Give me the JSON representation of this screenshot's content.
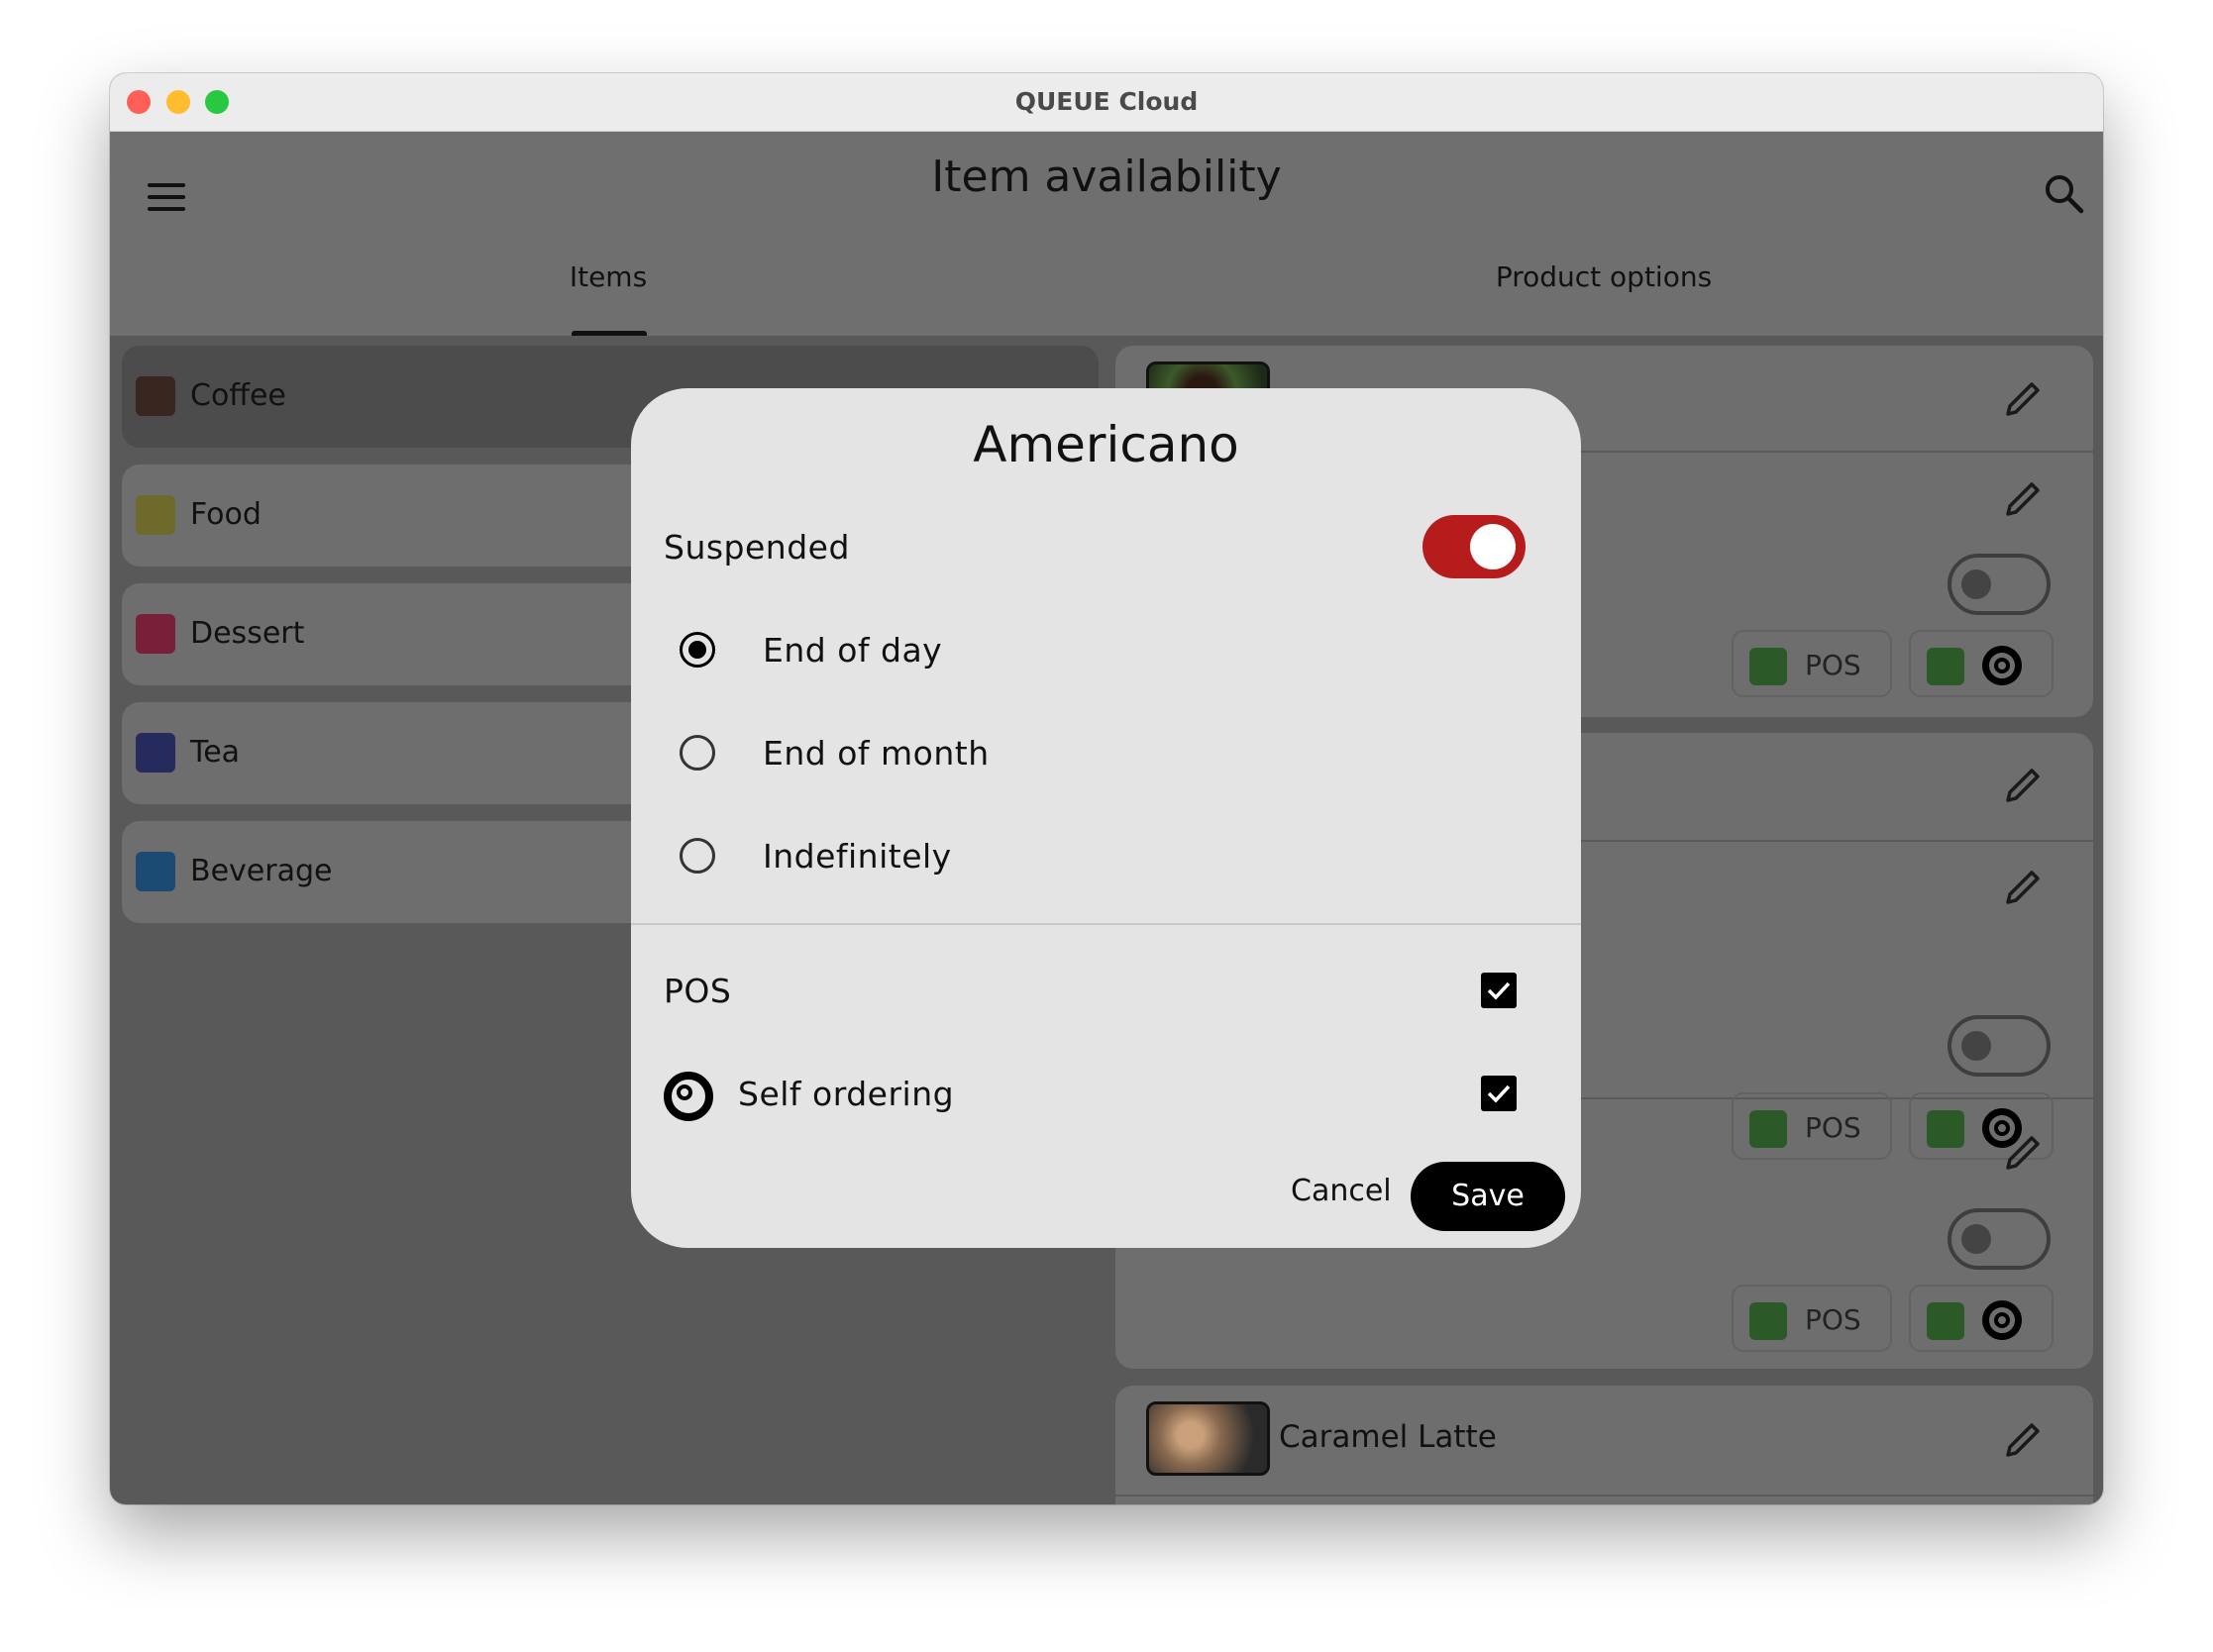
{
  "window": {
    "title": "QUEUE Cloud",
    "traffic_lights": {
      "close": "#fe5f57",
      "minimize": "#febc2e",
      "zoom": "#28c840"
    }
  },
  "appbar": {
    "title": "Item availability",
    "menu_icon": "hamburger-icon",
    "search_icon": "search-icon"
  },
  "tabs": [
    {
      "label": "Items",
      "selected": true
    },
    {
      "label": "Product options",
      "selected": false
    }
  ],
  "categories": [
    {
      "label": "Coffee",
      "color": "#3a2620",
      "selected": true
    },
    {
      "label": "Food",
      "color": "#6e6a2c"
    },
    {
      "label": "Dessert",
      "color": "#7a1f3a"
    },
    {
      "label": "Tea",
      "color": "#262a5c"
    },
    {
      "label": "Beverage",
      "color": "#1b4a72"
    }
  ],
  "products": {
    "chip_pos_label": "POS",
    "visible_item": "Caramel Latte"
  },
  "dialog": {
    "title": "Americano",
    "suspended_label": "Suspended",
    "suspended": true,
    "options": [
      {
        "label": "End of day",
        "selected": true
      },
      {
        "label": "End of month",
        "selected": false
      },
      {
        "label": "Indefinitely",
        "selected": false
      }
    ],
    "channels": [
      {
        "label": "POS",
        "checked": true
      },
      {
        "label": "Self ordering",
        "checked": true
      }
    ],
    "cancel_label": "Cancel",
    "save_label": "Save",
    "accent": "#b71c1c"
  }
}
